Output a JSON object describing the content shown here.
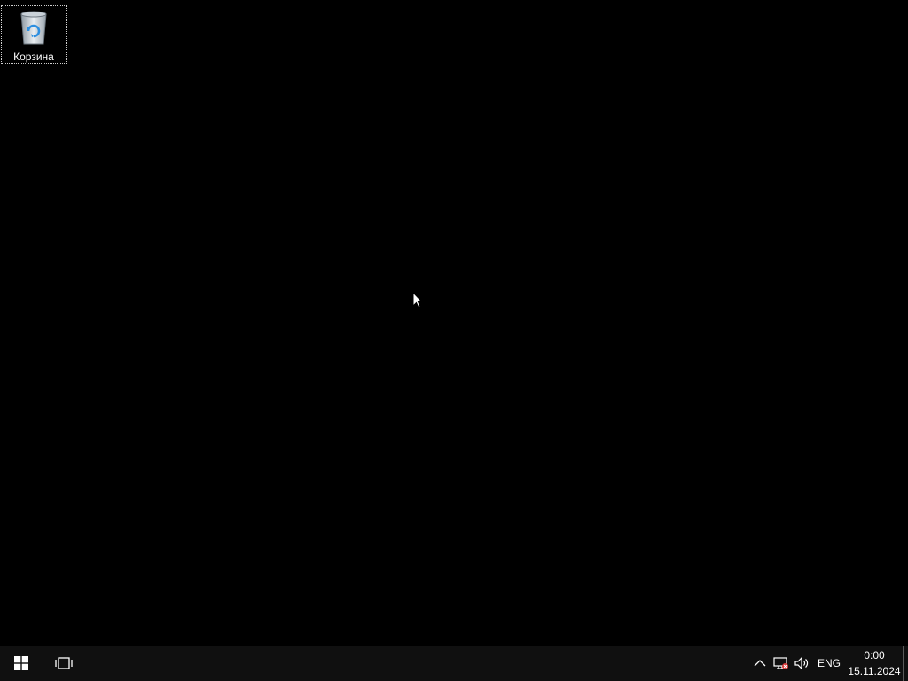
{
  "desktop": {
    "background_color": "#000000",
    "icons": [
      {
        "label": "Корзина",
        "icon": "recycle-bin-icon"
      }
    ]
  },
  "taskbar": {
    "background_color": "#101010",
    "start_icon": "windows-logo-icon",
    "task_view_icon": "task-view-icon",
    "tray": {
      "chevron_icon": "chevron-up-icon",
      "network_icon": "network-disconnected-icon",
      "volume_icon": "volume-icon",
      "language": "ENG",
      "time": "0:00",
      "date": "15.11.2024"
    }
  }
}
